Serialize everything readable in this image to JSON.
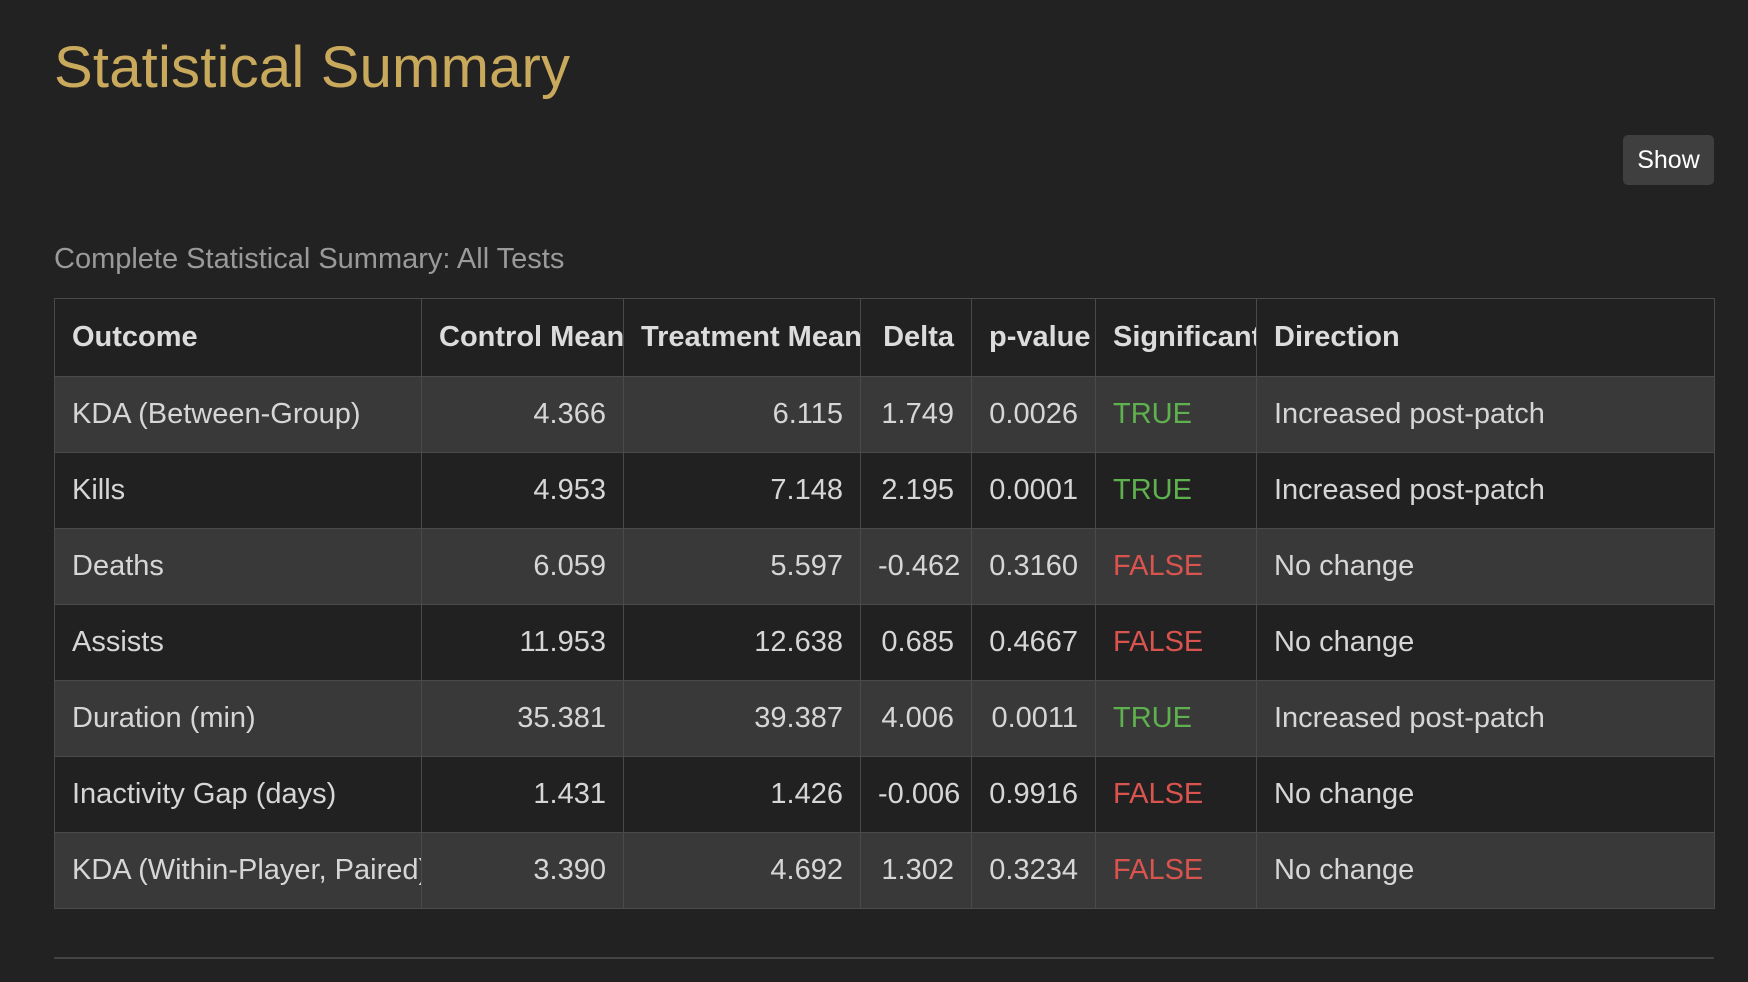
{
  "page": {
    "title": "Statistical Summary",
    "show_button_label": "Show",
    "caption": "Complete Statistical Summary: All Tests"
  },
  "colors": {
    "title": "#c9a95c",
    "significant_true": "#5fb14f",
    "significant_false": "#d9534f",
    "background": "#222222"
  },
  "table": {
    "headers": [
      "Outcome",
      "Control Mean",
      "Treatment Mean",
      "Delta",
      "p-value",
      "Significant",
      "Direction"
    ],
    "rows": [
      [
        "KDA (Between-Group)",
        "4.366",
        "6.115",
        "1.749",
        "0.0026",
        "TRUE",
        "Increased post-patch"
      ],
      [
        "Kills",
        "4.953",
        "7.148",
        "2.195",
        "0.0001",
        "TRUE",
        "Increased post-patch"
      ],
      [
        "Deaths",
        "6.059",
        "5.597",
        "-0.462",
        "0.3160",
        "FALSE",
        "No change"
      ],
      [
        "Assists",
        "11.953",
        "12.638",
        "0.685",
        "0.4667",
        "FALSE",
        "No change"
      ],
      [
        "Duration (min)",
        "35.381",
        "39.387",
        "4.006",
        "0.0011",
        "TRUE",
        "Increased post-patch"
      ],
      [
        "Inactivity Gap (days)",
        "1.431",
        "1.426",
        "-0.006",
        "0.9916",
        "FALSE",
        "No change"
      ],
      [
        "KDA (Within-Player, Paired)",
        "3.390",
        "4.692",
        "1.302",
        "0.3234",
        "FALSE",
        "No change"
      ]
    ]
  }
}
